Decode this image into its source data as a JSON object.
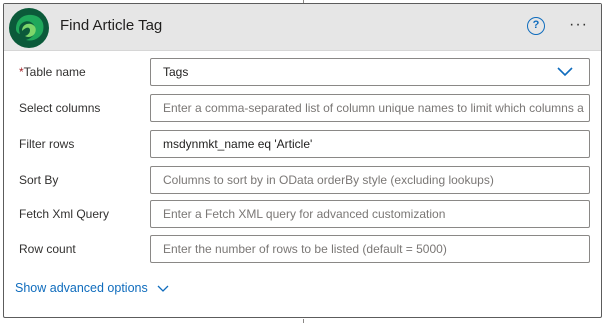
{
  "header": {
    "title": "Find Article Tag",
    "help_icon": "?",
    "more_icon": "···"
  },
  "fields": [
    {
      "label": "Table name",
      "required": true,
      "required_mark": "*",
      "value": "Tags",
      "placeholder": "",
      "type": "select"
    },
    {
      "label": "Select columns",
      "required": false,
      "value": "",
      "placeholder": "Enter a comma-separated list of column unique names to limit which columns a"
    },
    {
      "label": "Filter rows",
      "required": false,
      "value": "msdynmkt_name eq 'Article'",
      "placeholder": ""
    },
    {
      "label": "Sort By",
      "required": false,
      "value": "",
      "placeholder": "Columns to sort by in OData orderBy style (excluding lookups)"
    },
    {
      "label": "Fetch Xml Query",
      "required": false,
      "value": "",
      "placeholder": "Enter a Fetch XML query for advanced customization"
    },
    {
      "label": "Row count",
      "required": false,
      "value": "",
      "placeholder": "Enter the number of rows to be listed (default = 5000)"
    }
  ],
  "advanced_options": {
    "label": "Show advanced options"
  },
  "colors": {
    "accent": "#0f6cbd",
    "required": "#a4262c",
    "header_bg": "#e6e6e6"
  }
}
